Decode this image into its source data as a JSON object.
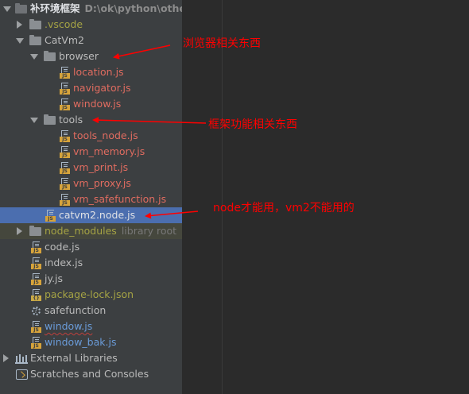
{
  "project": {
    "root_name": "补环境框架",
    "root_path": "D:\\ok\\python\\other_c"
  },
  "tree": {
    "vscode": ".vscode",
    "catvm2": "CatVm2",
    "browser": "browser",
    "location": "location.js",
    "navigator": "navigator.js",
    "window_in_browser": "window.js",
    "tools": "tools",
    "tools_node": "tools_node.js",
    "vm_memory": "vm_memory.js",
    "vm_print": "vm_print.js",
    "vm_proxy": "vm_proxy.js",
    "vm_safefunction": "vm_safefunction.js",
    "catvm2_node": "catvm2.node.js",
    "node_modules": "node_modules",
    "node_modules_note": "library root",
    "code": "code.js",
    "index": "index.js",
    "jy": "jy.js",
    "package_lock": "package-lock.json",
    "safefunction": "safefunction",
    "window": "window.js",
    "window_bak": "window_bak.js",
    "external_libraries": "External Libraries",
    "scratches": "Scratches and Consoles"
  },
  "annotations": {
    "browser_note": "浏览器相关东西",
    "tools_note": "框架功能相关东西",
    "node_note": "node才能用，vm2不能用的"
  },
  "colors": {
    "annotation": "#ff0000",
    "selection": "#4b6eaf",
    "panel_bg": "#3c3f41",
    "editor_bg": "#2b2b2b"
  }
}
